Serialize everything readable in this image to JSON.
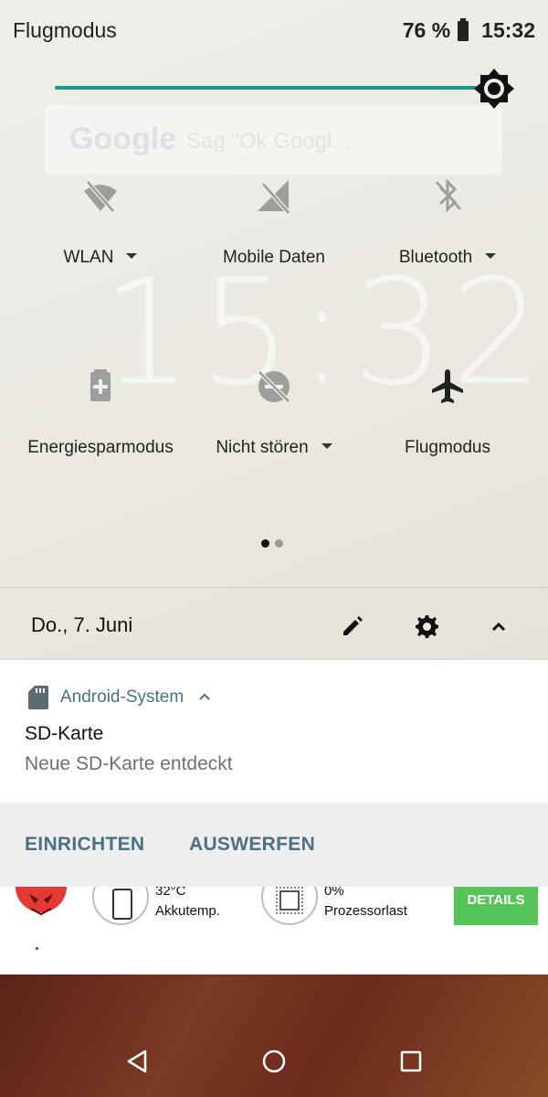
{
  "status_bar": {
    "carrier": "Flugmodus",
    "battery": "76 %",
    "time": "15:32"
  },
  "brightness": {
    "level_percent": 94,
    "accent": "#139a8a"
  },
  "background": {
    "search_brand": "Google",
    "search_hint": "Sag \"Ok Googl...",
    "clock": "15:32"
  },
  "tiles": [
    {
      "label": "WLAN",
      "icon": "wifi-off-icon",
      "has_menu": true,
      "active": false
    },
    {
      "label": "Mobile Daten",
      "icon": "mobile-data-off-icon",
      "has_menu": false,
      "active": false
    },
    {
      "label": "Bluetooth",
      "icon": "bluetooth-off-icon",
      "has_menu": true,
      "active": false
    },
    {
      "label": "Energiesparmodus",
      "icon": "battery-saver-icon",
      "has_menu": false,
      "active": false
    },
    {
      "label": "Nicht stören",
      "icon": "do-not-disturb-off-icon",
      "has_menu": true,
      "active": false
    },
    {
      "label": "Flugmodus",
      "icon": "airplane-icon",
      "has_menu": false,
      "active": true
    }
  ],
  "pager": {
    "pages": 2,
    "current": 1
  },
  "date_row": {
    "date": "Do., 7. Juni"
  },
  "notification": {
    "app_name": "Android-System",
    "title": "SD-Karte",
    "text": "Neue SD-Karte entdeckt",
    "actions": [
      "EINRICHTEN",
      "AUSWERFEN"
    ]
  },
  "widget": {
    "temp_value": "32°C",
    "temp_label": "Akkutemp.",
    "cpu_value": "0%",
    "cpu_label": "Prozessorlast",
    "button": "DETAILS",
    "button_color": "#57c45a"
  }
}
